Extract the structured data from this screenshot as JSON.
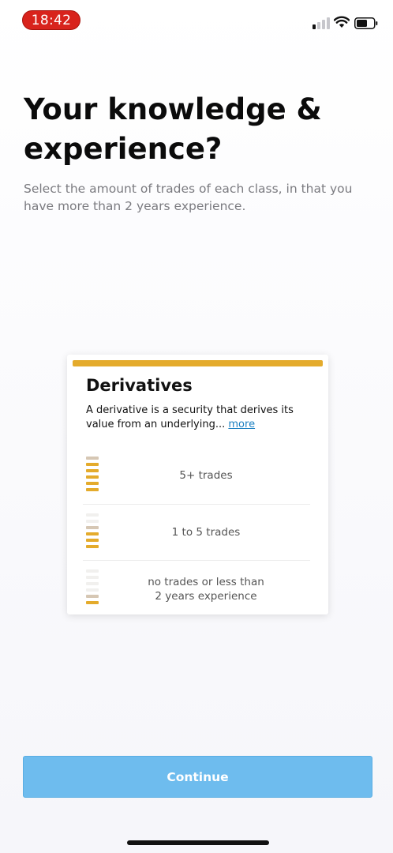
{
  "status_bar": {
    "time": "18:42",
    "icons": [
      "signal-icon",
      "wifi-icon",
      "battery-icon"
    ]
  },
  "header": {
    "title": "Your knowledge & experience?",
    "subtitle": "Select the amount of trades of each class, in that you have more than 2 years experience."
  },
  "card": {
    "title": "Derivatives",
    "description": "A derivative is a security that derives its value from an underlying...",
    "more_link": "more",
    "options": [
      {
        "label": "5+ trades",
        "level": 5
      },
      {
        "label": "1 to 5 trades",
        "level": 3
      },
      {
        "label_line1": "no trades or less than",
        "label_line2": "2 years experience",
        "level": 1
      }
    ]
  },
  "footer": {
    "continue_label": "Continue"
  },
  "colors": {
    "accent": "#e4ab2c",
    "button": "#6ebcee",
    "link": "#1a7fc1",
    "time_pill": "#d8231c"
  }
}
